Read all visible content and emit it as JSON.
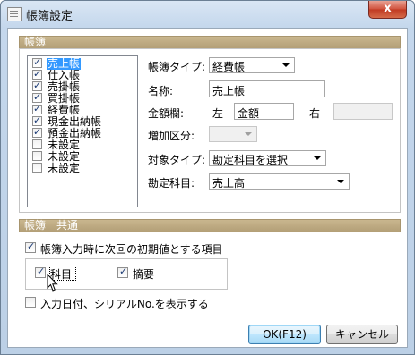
{
  "window": {
    "title": "帳簿設定",
    "close_glyph": "x"
  },
  "group1": {
    "label": "帳簿"
  },
  "list": [
    {
      "label": "売上帳",
      "checked": true,
      "selected": true
    },
    {
      "label": "仕入帳",
      "checked": true
    },
    {
      "label": "売掛帳",
      "checked": true
    },
    {
      "label": "買掛帳",
      "checked": true
    },
    {
      "label": "経費帳",
      "checked": true
    },
    {
      "label": "現金出納帳",
      "checked": true
    },
    {
      "label": "預金出納帳",
      "checked": true
    },
    {
      "label": "未設定",
      "checked": false
    },
    {
      "label": "未設定",
      "checked": false
    },
    {
      "label": "未設定",
      "checked": false
    }
  ],
  "form": {
    "book_type_label": "帳簿タイプ:",
    "book_type_value": "経費帳",
    "name_label": "名称:",
    "name_value": "売上帳",
    "amount_col_label": "金額欄:",
    "left_label": "左",
    "left_value": "金額",
    "right_label": "右",
    "right_value": "",
    "increase_label": "増加区分:",
    "increase_value": "",
    "target_type_label": "対象タイプ:",
    "target_type_value": "勘定科目を選択",
    "account_label": "勘定科目:",
    "account_value": "売上高"
  },
  "group2": {
    "label": "帳簿　共通"
  },
  "options": {
    "initial_value_label": "帳簿入力時に次回の初期値とする項目",
    "initial_value_checked": true,
    "subject_label": "科目",
    "subject_checked": true,
    "summary_label": "摘要",
    "summary_checked": true,
    "show_date_label": "入力日付、シリアルNo.を表示する",
    "show_date_checked": false
  },
  "buttons": {
    "ok": "OK(F12)",
    "cancel": "キャンセル"
  }
}
